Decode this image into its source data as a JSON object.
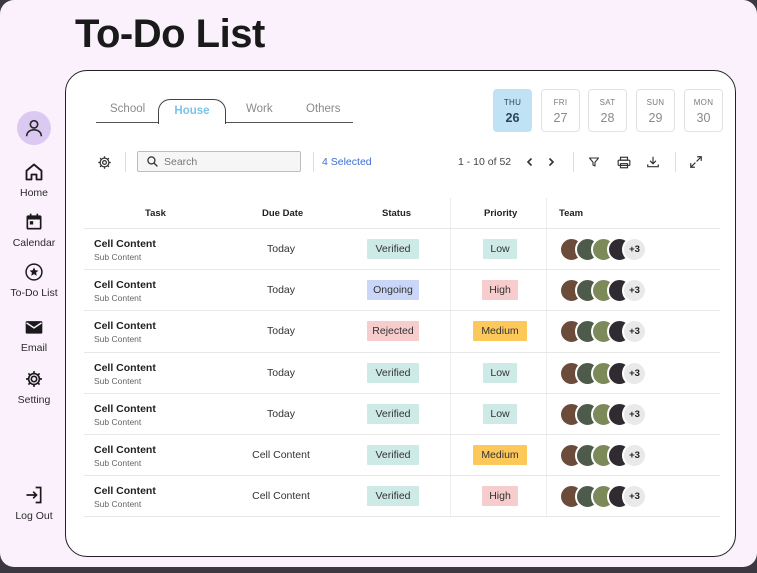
{
  "page": {
    "title": "To-Do List"
  },
  "sidebar": {
    "items": [
      {
        "label": "Home",
        "icon": "home-icon"
      },
      {
        "label": "Calendar",
        "icon": "calendar-icon"
      },
      {
        "label": "To-Do List",
        "icon": "star-circle-icon"
      },
      {
        "label": "Email",
        "icon": "mail-icon"
      },
      {
        "label": "Setting",
        "icon": "gear-icon"
      }
    ],
    "logout": {
      "label": "Log Out",
      "icon": "logout-icon"
    }
  },
  "tabs": [
    {
      "label": "School",
      "active": false
    },
    {
      "label": "House",
      "active": true
    },
    {
      "label": "Work",
      "active": false
    },
    {
      "label": "Others",
      "active": false
    }
  ],
  "days": [
    {
      "name": "THU",
      "num": "26",
      "active": true
    },
    {
      "name": "FRI",
      "num": "27",
      "active": false
    },
    {
      "name": "SAT",
      "num": "28",
      "active": false
    },
    {
      "name": "SUN",
      "num": "29",
      "active": false
    },
    {
      "name": "MON",
      "num": "30",
      "active": false
    }
  ],
  "toolbar": {
    "search_placeholder": "Search",
    "selected": "4 Selected",
    "pager": "1 - 10  of 52"
  },
  "table": {
    "headers": {
      "task": "Task",
      "due": "Due Date",
      "status": "Status",
      "priority": "Priority",
      "team": "Team"
    },
    "rows": [
      {
        "title": "Cell Content",
        "sub": "Sub Content",
        "due": "Today",
        "status": "Verified",
        "priority": "Low",
        "more": "+3"
      },
      {
        "title": "Cell Content",
        "sub": "Sub Content",
        "due": "Today",
        "status": "Ongoing",
        "priority": "High",
        "more": "+3"
      },
      {
        "title": "Cell Content",
        "sub": "Sub Content",
        "due": "Today",
        "status": "Rejected",
        "priority": "Medium",
        "more": "+3"
      },
      {
        "title": "Cell Content",
        "sub": "Sub Content",
        "due": "Today",
        "status": "Verified",
        "priority": "Low",
        "more": "+3"
      },
      {
        "title": "Cell Content",
        "sub": "Sub Content",
        "due": "Today",
        "status": "Verified",
        "priority": "Low",
        "more": "+3"
      },
      {
        "title": "Cell Content",
        "sub": "Sub Content",
        "due": "Cell Content",
        "status": "Verified",
        "priority": "Medium",
        "more": "+3"
      },
      {
        "title": "Cell Content",
        "sub": "Sub Content",
        "due": "Cell Content",
        "status": "Verified",
        "priority": "High",
        "more": "+3"
      }
    ]
  },
  "colors": {
    "app_bg": "#fbf1fd",
    "accent_tab": "#7cc3e6",
    "active_day": "#bfe3f5",
    "status": {
      "Verified": "#cdeae6",
      "Ongoing": "#c9d6f7",
      "Rejected": "#f6cccc"
    },
    "priority": {
      "Low": "#cdeae6",
      "High": "#f6cccc",
      "Medium": "#fdc85a"
    }
  }
}
